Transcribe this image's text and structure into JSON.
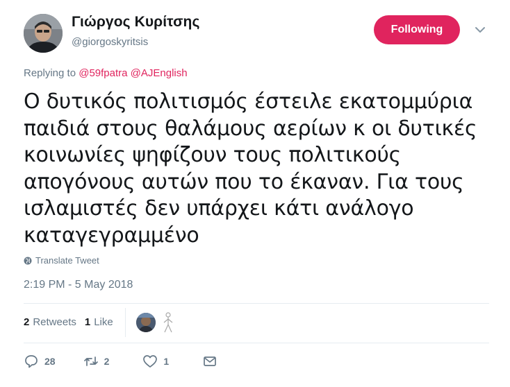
{
  "author": {
    "name": "Γιώργος Κυρίτσης",
    "handle": "@giorgoskyritsis"
  },
  "follow_button": "Following",
  "reply": {
    "prefix": "Replying to",
    "mentions": [
      "@59fpatra",
      "@AJEnglish"
    ]
  },
  "tweet": {
    "text": "Ο δυτικός πολιτισμός έστειλε εκατομμύρια\nπαιδιά στους θαλάμους αερίων κ οι δυτικές\nκοινωνίες ψηφίζουν τους πολιτικούς\nαπογόνους αυτών που το έκαναν. Για τους\nισλαμιστές δεν υπάρχει κάτι ανάλογο\nκαταγεγραμμένο"
  },
  "translate_label": "Translate Tweet",
  "timestamp": "2:19 PM - 5 May 2018",
  "stats": {
    "retweets_count": "2",
    "retweets_label": "Retweets",
    "likes_count": "1",
    "likes_label": "Like"
  },
  "actions": {
    "reply_count": "28",
    "retweet_count": "2",
    "like_count": "1"
  },
  "colors": {
    "accent": "#e0245e",
    "muted": "#657786",
    "text": "#14171a"
  },
  "icons": [
    "caret-down-icon",
    "globe-icon",
    "reply-icon",
    "retweet-icon",
    "heart-icon",
    "message-icon"
  ]
}
